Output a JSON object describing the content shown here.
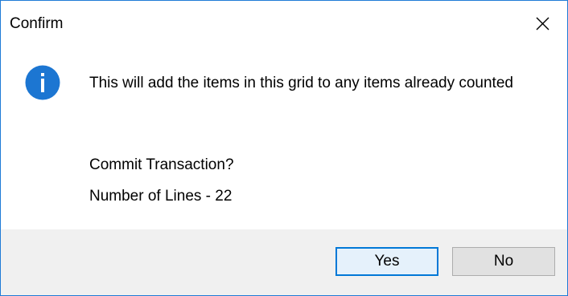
{
  "dialog": {
    "title": "Confirm",
    "close_icon": "close-icon",
    "icon": "info-icon",
    "message_line": "This will add the items in this grid to any items already counted",
    "question": "Commit Transaction?",
    "detail": "Number of Lines - 22",
    "buttons": {
      "yes_label": "Yes",
      "no_label": "No"
    },
    "colors": {
      "accent": "#0078d7",
      "info_icon": "#1c76d2",
      "footer_bg": "#f0f0f0",
      "button_bg": "#e1e1e1"
    }
  }
}
